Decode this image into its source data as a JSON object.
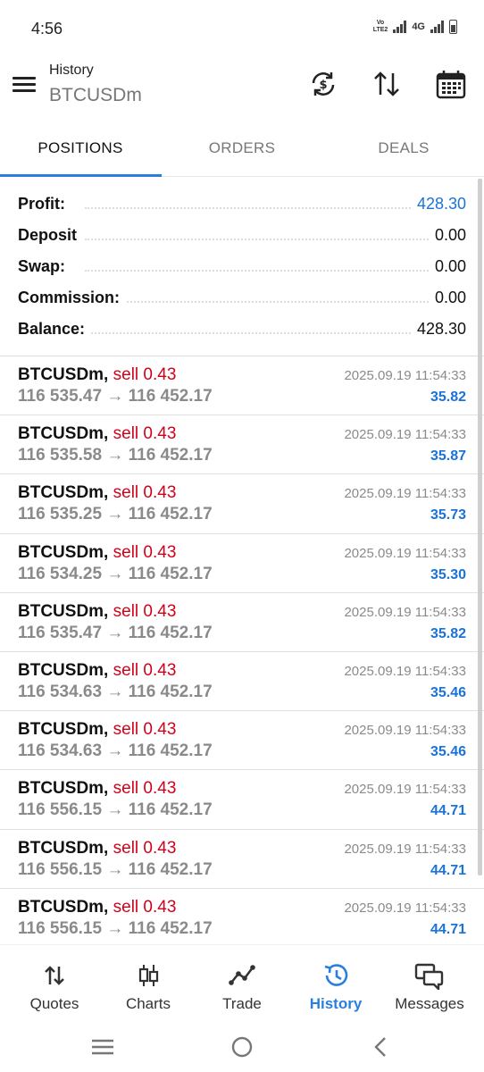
{
  "status_bar": {
    "time": "4:56",
    "volte_label": "VoLTE2",
    "network": "4G"
  },
  "header": {
    "title": "History",
    "subtitle": "BTCUSDm",
    "icons": [
      "menu-icon",
      "currency-exchange-icon",
      "sort-icon",
      "calendar-icon"
    ]
  },
  "tabs": [
    {
      "label": "POSITIONS",
      "active": true
    },
    {
      "label": "ORDERS",
      "active": false
    },
    {
      "label": "DEALS",
      "active": false
    }
  ],
  "summary": {
    "profit": {
      "label": "Profit:",
      "value": "428.30"
    },
    "deposit": {
      "label": "Deposit",
      "value": "0.00"
    },
    "swap": {
      "label": "Swap:",
      "value": "0.00"
    },
    "commission": {
      "label": "Commission:",
      "value": "0.00"
    },
    "balance": {
      "label": "Balance:",
      "value": "428.30"
    }
  },
  "positions": [
    {
      "symbol": "BTCUSDm,",
      "side": "sell 0.43",
      "open": "116 535.47",
      "arrow": "→",
      "close": "116 452.17",
      "time": "2025.09.19 11:54:33",
      "profit": "35.82"
    },
    {
      "symbol": "BTCUSDm,",
      "side": "sell 0.43",
      "open": "116 535.58",
      "arrow": "→",
      "close": "116 452.17",
      "time": "2025.09.19 11:54:33",
      "profit": "35.87"
    },
    {
      "symbol": "BTCUSDm,",
      "side": "sell 0.43",
      "open": "116 535.25",
      "arrow": "→",
      "close": "116 452.17",
      "time": "2025.09.19 11:54:33",
      "profit": "35.73"
    },
    {
      "symbol": "BTCUSDm,",
      "side": "sell 0.43",
      "open": "116 534.25",
      "arrow": "→",
      "close": "116 452.17",
      "time": "2025.09.19 11:54:33",
      "profit": "35.30"
    },
    {
      "symbol": "BTCUSDm,",
      "side": "sell 0.43",
      "open": "116 535.47",
      "arrow": "→",
      "close": "116 452.17",
      "time": "2025.09.19 11:54:33",
      "profit": "35.82"
    },
    {
      "symbol": "BTCUSDm,",
      "side": "sell 0.43",
      "open": "116 534.63",
      "arrow": "→",
      "close": "116 452.17",
      "time": "2025.09.19 11:54:33",
      "profit": "35.46"
    },
    {
      "symbol": "BTCUSDm,",
      "side": "sell 0.43",
      "open": "116 534.63",
      "arrow": "→",
      "close": "116 452.17",
      "time": "2025.09.19 11:54:33",
      "profit": "35.46"
    },
    {
      "symbol": "BTCUSDm,",
      "side": "sell 0.43",
      "open": "116 556.15",
      "arrow": "→",
      "close": "116 452.17",
      "time": "2025.09.19 11:54:33",
      "profit": "44.71"
    },
    {
      "symbol": "BTCUSDm,",
      "side": "sell 0.43",
      "open": "116 556.15",
      "arrow": "→",
      "close": "116 452.17",
      "time": "2025.09.19 11:54:33",
      "profit": "44.71"
    },
    {
      "symbol": "BTCUSDm,",
      "side": "sell 0.43",
      "open": "116 556.15",
      "arrow": "→",
      "close": "116 452.17",
      "time": "2025.09.19 11:54:33",
      "profit": "44.71"
    }
  ],
  "bottom_nav": [
    {
      "label": "Quotes",
      "icon": "quotes-icon",
      "active": false
    },
    {
      "label": "Charts",
      "icon": "candlestick-chart-icon",
      "active": false
    },
    {
      "label": "Trade",
      "icon": "trade-line-icon",
      "active": false
    },
    {
      "label": "History",
      "icon": "history-icon",
      "active": true
    },
    {
      "label": "Messages",
      "icon": "messages-icon",
      "active": false
    }
  ],
  "colors": {
    "accent": "#2a7fde",
    "profit_blue": "#1a73d9",
    "sell_red": "#d0021b",
    "muted_gray": "#8a8a8a"
  }
}
